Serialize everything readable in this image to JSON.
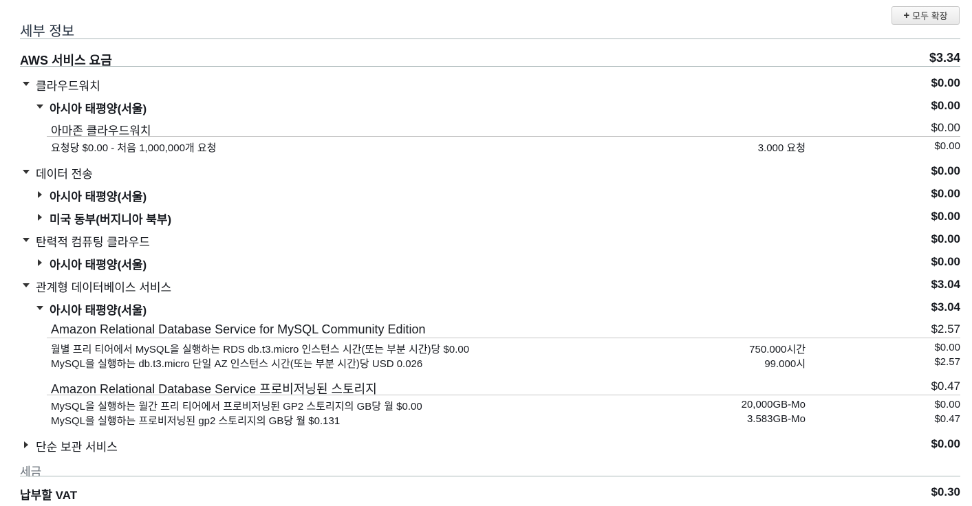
{
  "header": {
    "title": "세부 정보",
    "expand_all_label": "모두 확장"
  },
  "aws_services": {
    "label": "AWS 서비스 요금",
    "amount": "$3.34"
  },
  "cloudwatch": {
    "label": "클라우드워치",
    "amount": "$0.00",
    "region": {
      "label": "아시아 태평양(서울)",
      "amount": "$0.00"
    },
    "service": {
      "label": "아마존 클라우드워치",
      "amount": "$0.00"
    },
    "items": [
      {
        "desc": "요청당 $0.00 - 처음 1,000,000개 요청",
        "qty": "3.000 요청",
        "amount": "$0.00"
      }
    ]
  },
  "data_transfer": {
    "label": "데이터 전송",
    "amount": "$0.00",
    "regions": [
      {
        "label": "아시아 태평양(서울)",
        "amount": "$0.00"
      },
      {
        "label": "미국 동부(버지니아 북부)",
        "amount": "$0.00"
      }
    ]
  },
  "ec2": {
    "label": "탄력적 컴퓨팅 클라우드",
    "amount": "$0.00",
    "region": {
      "label": "아시아 태평양(서울)",
      "amount": "$0.00"
    }
  },
  "rds": {
    "label": "관계형 데이터베이스 서비스",
    "amount": "$3.04",
    "region": {
      "label": "아시아 태평양(서울)",
      "amount": "$3.04"
    },
    "groups": [
      {
        "label": "Amazon Relational Database Service for MySQL Community Edition",
        "amount": "$2.57",
        "items": [
          {
            "desc": "월별 프리 티어에서 MySQL을 실행하는 RDS db.t3.micro 인스턴스 시간(또는 부분 시간)당 $0.00",
            "qty": "750.000시간",
            "amount": "$0.00"
          },
          {
            "desc": "MySQL을 실행하는 db.t3.micro 단일 AZ 인스턴스 시간(또는 부분 시간)당 USD 0.026",
            "qty": "99.000시",
            "amount": "$2.57"
          }
        ]
      },
      {
        "label": "Amazon Relational Database Service 프로비저닝된 스토리지",
        "amount": "$0.47",
        "items": [
          {
            "desc": "MySQL을 실행하는 월간 프리 티어에서 프로비저닝된 GP2 스토리지의 GB당 월 $0.00",
            "qty": "20,000GB-Mo",
            "amount": "$0.00"
          },
          {
            "desc": "MySQL을 실행하는 프로비저닝된 gp2 스토리지의 GB당 월 $0.131",
            "qty": "3.583GB-Mo",
            "amount": "$0.47"
          }
        ]
      }
    ]
  },
  "simple_storage": {
    "label": "단순 보관 서비스",
    "amount": "$0.00"
  },
  "tax": {
    "title": "세금",
    "vat_label": "납부할 VAT",
    "vat_amount": "$0.30"
  }
}
